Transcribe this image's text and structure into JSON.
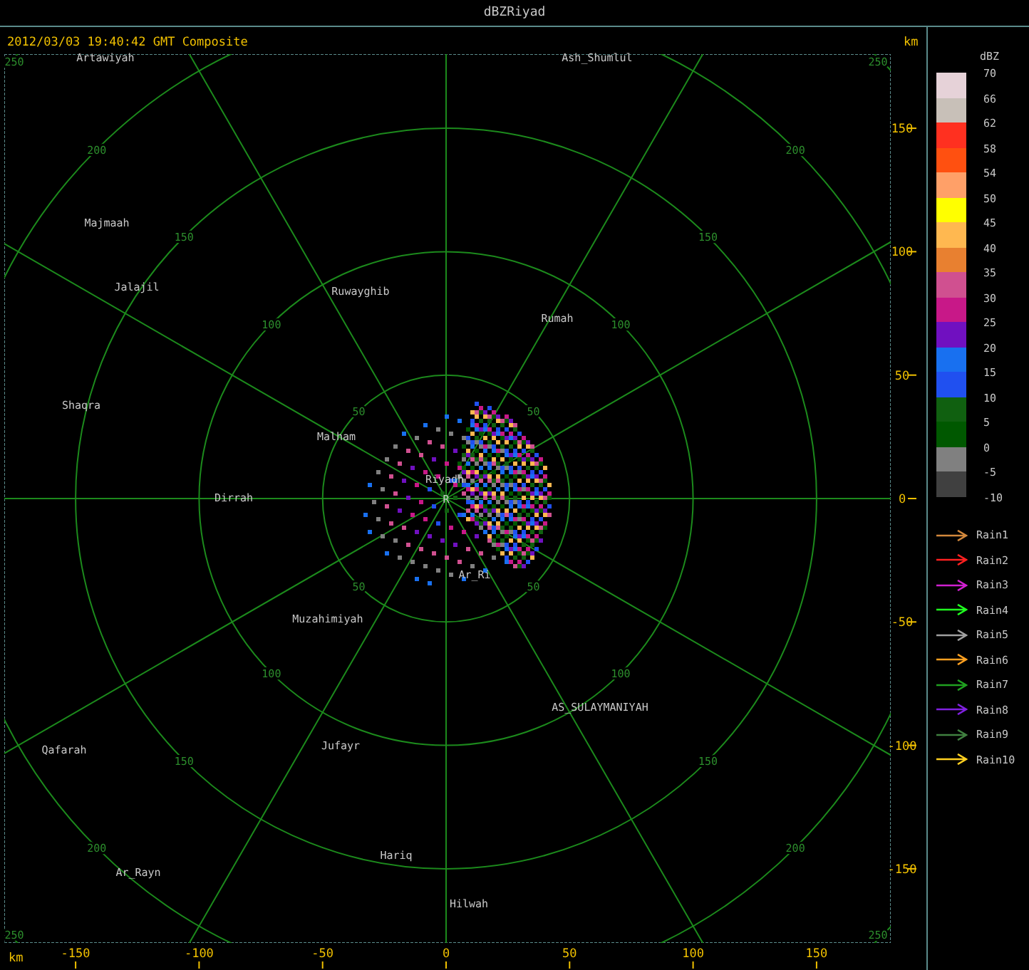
{
  "window": {
    "title": "dBZRiyad"
  },
  "header": {
    "timestamp": "2012/03/03 19:40:42 GMT Composite"
  },
  "rings": [
    {
      "labels": [
        "50",
        "50",
        "50",
        "50"
      ]
    },
    {
      "labels": [
        "100",
        "100",
        "100",
        "100"
      ]
    },
    {
      "labels": [
        "150",
        "150",
        "150",
        "150"
      ]
    },
    {
      "labels": [
        "200",
        "200",
        "200",
        "200"
      ]
    },
    {
      "labels": [
        "250",
        "250",
        "250",
        "250"
      ]
    }
  ],
  "places": [
    {
      "name": "Artawiyah"
    },
    {
      "name": "Ash_Shumlul"
    },
    {
      "name": "Majmaah"
    },
    {
      "name": "Jalajil"
    },
    {
      "name": "Ruwayghib"
    },
    {
      "name": "Rumah"
    },
    {
      "name": "Shaqra"
    },
    {
      "name": "Malham"
    },
    {
      "name": "Riyadh"
    },
    {
      "name": "Dirrah"
    },
    {
      "name": "Ar_Ri"
    },
    {
      "name": "Muzahimiyah"
    },
    {
      "name": "AS_SULAYMANIYAH"
    },
    {
      "name": "Qafarah"
    },
    {
      "name": "Jufayr"
    },
    {
      "name": "Hariq"
    },
    {
      "name": "Ar_Rayn"
    },
    {
      "name": "Hilwah"
    }
  ],
  "radar_mark": "R",
  "y_axis": {
    "unit": "km",
    "ticks": [
      "150",
      "100",
      "50",
      "0",
      "-50",
      "-100",
      "-150"
    ]
  },
  "x_axis": {
    "unit": "km",
    "ticks": [
      "-150",
      "-100",
      "-50",
      "0",
      "50",
      "100",
      "150"
    ]
  },
  "legend": {
    "title": "dBZ",
    "blocks": [
      {
        "color": "#e6d2d8"
      },
      {
        "color": "#c8c0b8"
      },
      {
        "color": "#ff3020"
      },
      {
        "color": "#ff5010"
      },
      {
        "color": "#ffa068"
      },
      {
        "color": "#ffff00"
      },
      {
        "color": "#ffb850"
      },
      {
        "color": "#e88030"
      },
      {
        "color": "#d05090"
      },
      {
        "color": "#c81888"
      },
      {
        "color": "#7010c0"
      },
      {
        "color": "#1870f0"
      },
      {
        "color": "#2050f0"
      },
      {
        "color": "#106010"
      },
      {
        "color": "#005800"
      },
      {
        "color": "#808080"
      },
      {
        "color": "#404040"
      }
    ],
    "labels": [
      "70",
      "66",
      "62",
      "58",
      "54",
      "50",
      "45",
      "40",
      "35",
      "30",
      "25",
      "20",
      "15",
      "10",
      "5",
      "0",
      "-5",
      "-10"
    ],
    "tracks": [
      {
        "label": "Rain1",
        "color": "#d2883c"
      },
      {
        "label": "Rain2",
        "color": "#ff2020"
      },
      {
        "label": "Rain3",
        "color": "#d020d0"
      },
      {
        "label": "Rain4",
        "color": "#20ff20"
      },
      {
        "label": "Rain5",
        "color": "#a0a0a0"
      },
      {
        "label": "Rain6",
        "color": "#ffa020"
      },
      {
        "label": "Rain7",
        "color": "#20a020"
      },
      {
        "label": "Rain8",
        "color": "#8020e0"
      },
      {
        "label": "Rain9",
        "color": "#408040"
      },
      {
        "label": "Rain10",
        "color": "#ffd020"
      }
    ]
  }
}
